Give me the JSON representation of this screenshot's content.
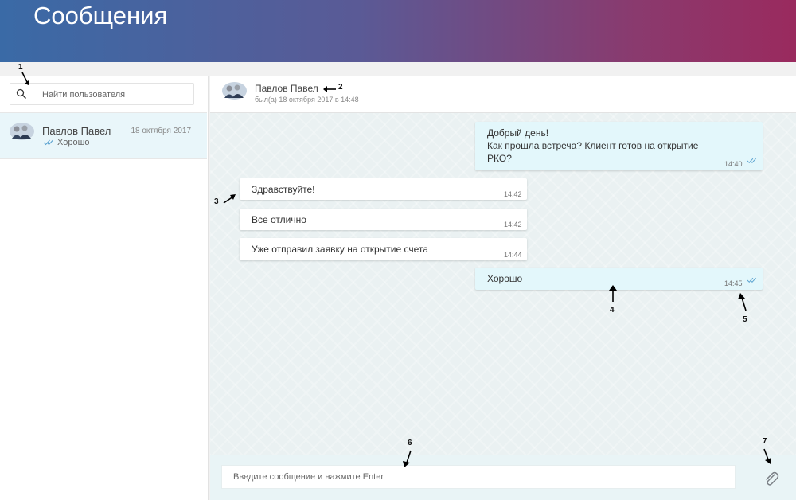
{
  "page": {
    "title": "Сообщения"
  },
  "search": {
    "placeholder": "Найти пользователя"
  },
  "contacts": [
    {
      "name": "Павлов Павел",
      "date": "18 октября 2017",
      "last_message": "Хорошо"
    }
  ],
  "chat": {
    "name": "Павлов Павел",
    "status": "был(а) 18 октября 2017 в 14:48"
  },
  "messages": [
    {
      "direction": "out",
      "text": "Добрый день!\nКак прошла встреча? Клиент готов на открытие\nРКО?",
      "time": "14:40",
      "read": true
    },
    {
      "direction": "in",
      "text": "Здравствуйте!",
      "time": "14:42"
    },
    {
      "direction": "in",
      "text": "Все отлично",
      "time": "14:42"
    },
    {
      "direction": "in",
      "text": "Уже отправил заявку на открытие счета",
      "time": "14:44"
    },
    {
      "direction": "out",
      "text": "Хорошо",
      "time": "14:45",
      "read": true
    }
  ],
  "composer": {
    "placeholder": "Введите сообщение и нажмите Enter"
  },
  "annotations": [
    "1",
    "2",
    "3",
    "4",
    "5",
    "6",
    "7"
  ],
  "colors": {
    "accent": "#5ba3d0",
    "header_start": "#3a6aa6",
    "header_end": "#9a2a5e",
    "outgoing": "#e3f7fb"
  },
  "icons": {
    "search": "search-icon",
    "attach": "paperclip-icon",
    "read": "double-check-icon"
  }
}
